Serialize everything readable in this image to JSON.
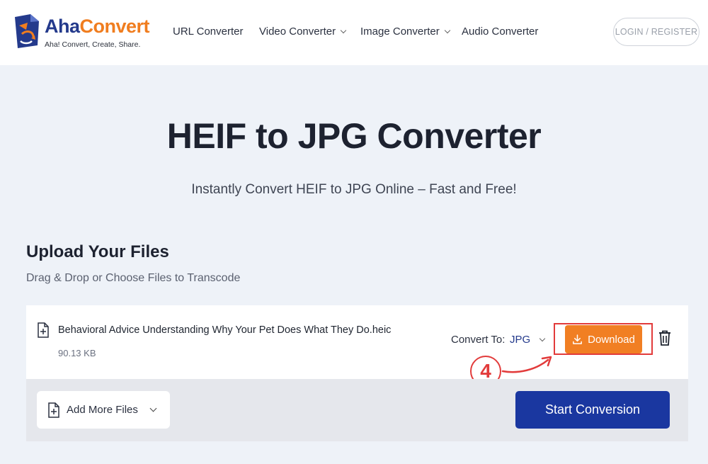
{
  "header": {
    "logo_aha": "Aha",
    "logo_convert": "Convert",
    "logo_tagline": "Aha! Convert, Create, Share.",
    "nav": [
      {
        "label": "URL Converter",
        "has_dropdown": false
      },
      {
        "label": "Video Converter",
        "has_dropdown": true
      },
      {
        "label": "Image Converter",
        "has_dropdown": true
      },
      {
        "label": "Audio Converter",
        "has_dropdown": false
      }
    ],
    "login_label": "LOGIN / REGISTER"
  },
  "hero": {
    "title": "HEIF to JPG Converter",
    "subtitle": "Instantly Convert HEIF to JPG Online – Fast and Free!"
  },
  "upload": {
    "title": "Upload Your Files",
    "subtitle": "Drag & Drop or Choose Files to Transcode"
  },
  "file": {
    "name": "Behavioral Advice Understanding Why Your Pet Does What They Do.heic",
    "size": "90.13 KB",
    "convert_to_label": "Convert To:",
    "format": "JPG",
    "download_label": "Download"
  },
  "annotation": {
    "step": "4"
  },
  "actions": {
    "add_more_label": "Add More Files",
    "start_label": "Start Conversion"
  },
  "colors": {
    "accent_orange": "#f17f23",
    "brand_blue": "#1a37a0",
    "annotation_red": "#e23b3b"
  }
}
